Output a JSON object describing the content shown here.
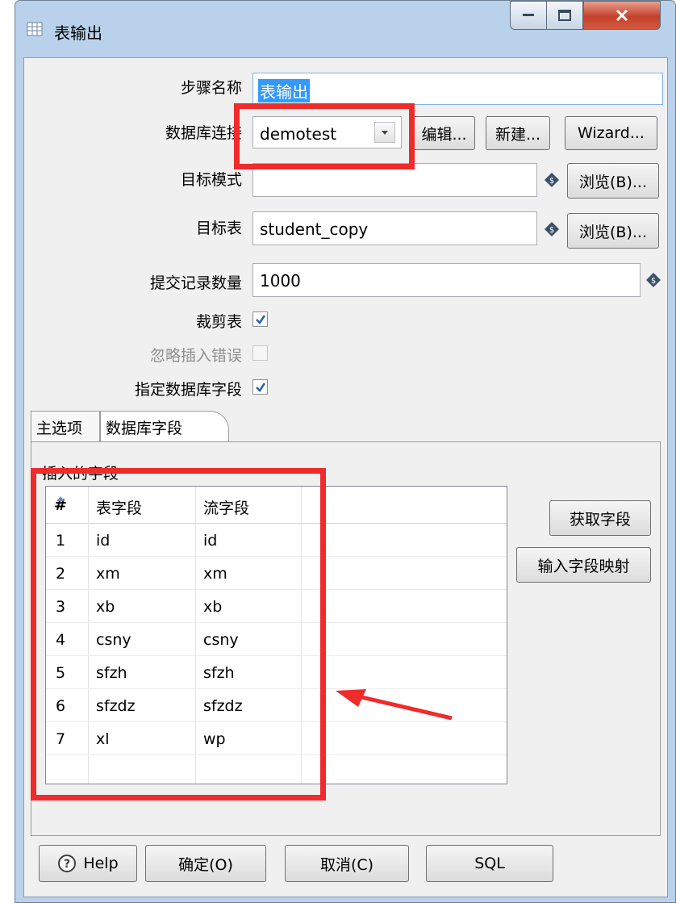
{
  "window": {
    "title": "表输出"
  },
  "form": {
    "step_name_label": "步骤名称",
    "step_name_value": "表输出",
    "db_conn_label": "数据库连接",
    "db_conn_value": "demotest",
    "edit_button": "编辑...",
    "new_button": "新建...",
    "wizard_button": "Wizard...",
    "target_schema_label": "目标模式",
    "target_schema_value": "",
    "browse_button_1": "浏览(B)...",
    "target_table_label": "目标表",
    "target_table_value": "student_copy",
    "browse_button_2": "浏览(B)...",
    "commit_size_label": "提交记录数量",
    "commit_size_value": "1000",
    "truncate_label": "裁剪表",
    "truncate_checked": true,
    "ignore_errors_label": "忽略插入错误",
    "ignore_errors_checked": false,
    "specify_fields_label": "指定数据库字段",
    "specify_fields_checked": true
  },
  "tabs": [
    {
      "label": "主选项",
      "active": false
    },
    {
      "label": "数据库字段",
      "active": true
    }
  ],
  "fields_panel": {
    "group_label": "插入的字段",
    "columns": [
      "#",
      "表字段",
      "流字段"
    ],
    "rows": [
      [
        "1",
        "id",
        "id"
      ],
      [
        "2",
        "xm",
        "xm"
      ],
      [
        "3",
        "xb",
        "xb"
      ],
      [
        "4",
        "csny",
        "csny"
      ],
      [
        "5",
        "sfzh",
        "sfzh"
      ],
      [
        "6",
        "sfzdz",
        "sfzdz"
      ],
      [
        "7",
        "xl",
        "wp"
      ]
    ],
    "get_fields_button": "获取字段",
    "map_fields_button": "输入字段映射"
  },
  "footer": {
    "help_button": "Help",
    "ok_button": "确定(O)",
    "cancel_button": "取消(C)",
    "sql_button": "SQL"
  },
  "colors": {
    "annotation_red": "#ef2b2b",
    "title_bar": "#b9d1ea",
    "selection_blue": "#3399ff"
  },
  "icons": {
    "window": "table-icon",
    "variable": "dollar-diamond-icon",
    "help": "question-circle-icon",
    "dropdown": "chevron-down-icon",
    "sort": "sort-up-icon"
  }
}
